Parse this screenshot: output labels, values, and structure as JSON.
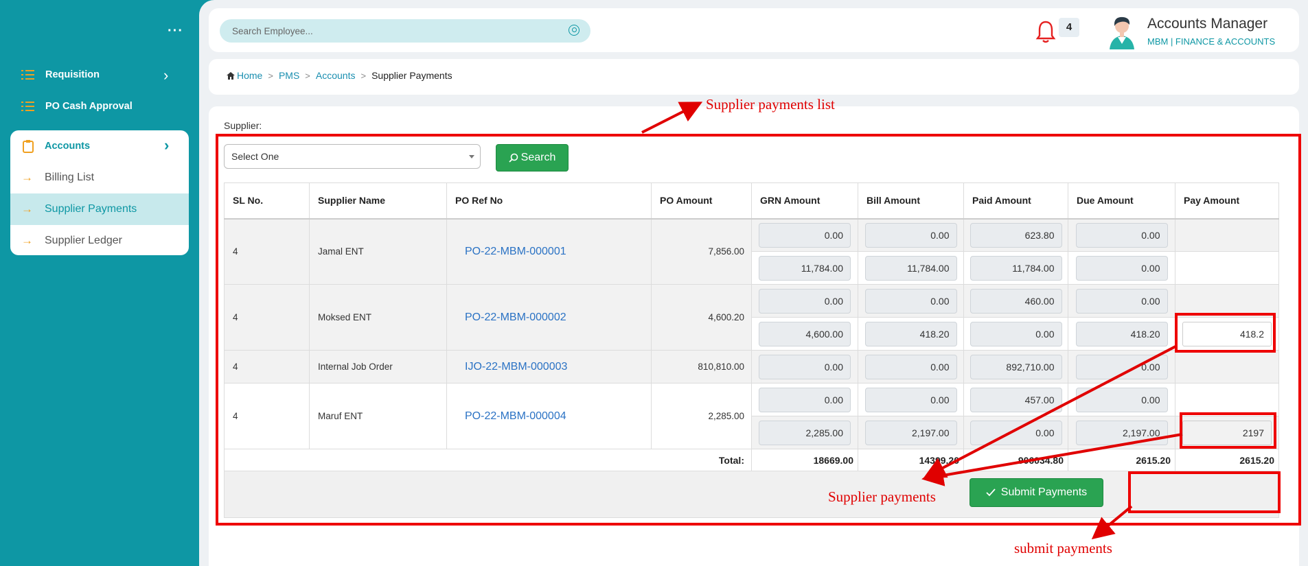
{
  "sidebar": {
    "menu": [
      "Requisition",
      "PO Cash Approval"
    ],
    "accounts": {
      "label": "Accounts",
      "items": [
        "Billing List",
        "Supplier Payments",
        "Supplier Ledger"
      ],
      "active": "Supplier Payments"
    }
  },
  "topbar": {
    "search_placeholder": "Search Employee...",
    "notification_count": "4",
    "user_name": "Accounts Manager",
    "user_org": "MBM  | FINANCE & ACCOUNTS"
  },
  "breadcrumb": [
    "Home",
    "PMS",
    "Accounts",
    "Supplier Payments"
  ],
  "form": {
    "supplier_label": "Supplier:",
    "supplier_select": "Select One",
    "search_button": "Search"
  },
  "table": {
    "headers": [
      "SL No.",
      "Supplier Name",
      "PO Ref No",
      "PO Amount",
      "GRN Amount",
      "Bill Amount",
      "Paid Amount",
      "Due Amount",
      "Pay Amount"
    ],
    "groups": [
      {
        "sl": "4",
        "supplier": "Jamal ENT",
        "po_ref": "PO-22-MBM-000001",
        "po_amount": "7,856.00",
        "lines": [
          {
            "grn": "0.00",
            "bill": "0.00",
            "paid": "623.80",
            "due": "0.00",
            "pay": ""
          },
          {
            "grn": "11,784.00",
            "bill": "11,784.00",
            "paid": "11,784.00",
            "due": "0.00",
            "pay": ""
          }
        ]
      },
      {
        "sl": "4",
        "supplier": "Moksed ENT",
        "po_ref": "PO-22-MBM-000002",
        "po_amount": "4,600.20",
        "lines": [
          {
            "grn": "0.00",
            "bill": "0.00",
            "paid": "460.00",
            "due": "0.00",
            "pay": ""
          },
          {
            "grn": "4,600.00",
            "bill": "418.20",
            "paid": "0.00",
            "due": "418.20",
            "pay": "418.2"
          }
        ]
      },
      {
        "sl": "4",
        "supplier": "Internal Job Order",
        "po_ref": "IJO-22-MBM-000003",
        "po_amount": "810,810.00",
        "lines": [
          {
            "grn": "0.00",
            "bill": "0.00",
            "paid": "892,710.00",
            "due": "0.00",
            "pay": ""
          }
        ]
      },
      {
        "sl": "4",
        "supplier": "Maruf ENT",
        "po_ref": "PO-22-MBM-000004",
        "po_amount": "2,285.00",
        "lines": [
          {
            "grn": "0.00",
            "bill": "0.00",
            "paid": "457.00",
            "due": "0.00",
            "pay": ""
          },
          {
            "grn": "2,285.00",
            "bill": "2,197.00",
            "paid": "0.00",
            "due": "2,197.00",
            "pay": "2197"
          }
        ]
      }
    ],
    "totals": {
      "label": "Total:",
      "grn": "18669.00",
      "bill": "14399.20",
      "paid": "906034.80",
      "due": "2615.20",
      "pay": "2615.20"
    },
    "submit_button": "Submit Payments"
  },
  "annotations": {
    "list": "Supplier payments list",
    "payments": "Supplier payments",
    "submit": "submit payments"
  }
}
